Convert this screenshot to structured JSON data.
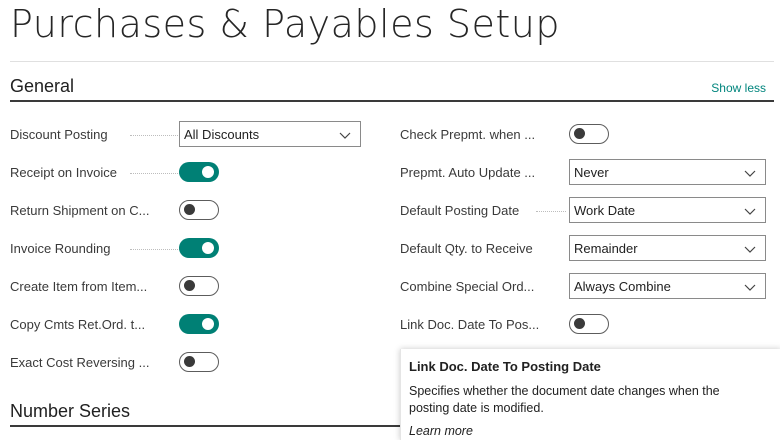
{
  "page": {
    "title": "Purchases & Payables Setup"
  },
  "general": {
    "title": "General",
    "show_less": "Show less",
    "left_fields": [
      {
        "label": "Discount Posting",
        "type": "select",
        "value": "All Discounts"
      },
      {
        "label": "Receipt on Invoice",
        "type": "toggle",
        "value": true
      },
      {
        "label": "Return Shipment on C...",
        "type": "toggle",
        "value": false
      },
      {
        "label": "Invoice Rounding",
        "type": "toggle",
        "value": true
      },
      {
        "label": "Create Item from Item...",
        "type": "toggle",
        "value": false
      },
      {
        "label": "Copy Cmts Ret.Ord. t...",
        "type": "toggle",
        "value": true
      },
      {
        "label": "Exact Cost Reversing ...",
        "type": "toggle",
        "value": false
      }
    ],
    "right_fields": [
      {
        "label": "Check Prepmt. when ...",
        "type": "toggle",
        "value": false
      },
      {
        "label": "Prepmt. Auto Update ...",
        "type": "select",
        "value": "Never"
      },
      {
        "label": "Default Posting Date",
        "type": "select",
        "value": "Work Date"
      },
      {
        "label": "Default Qty. to Receive",
        "type": "select",
        "value": "Remainder"
      },
      {
        "label": "Combine Special Ord...",
        "type": "select",
        "value": "Always Combine"
      },
      {
        "label": "Link Doc. Date To Pos...",
        "type": "toggle",
        "value": false
      }
    ]
  },
  "number_series": {
    "title": "Number Series"
  },
  "tooltip": {
    "title": "Link Doc. Date To Posting Date",
    "body": "Specifies whether the document date changes when the posting date is modified.",
    "link": "Learn more"
  },
  "colors": {
    "accent": "#008075",
    "link": "#00857d"
  }
}
